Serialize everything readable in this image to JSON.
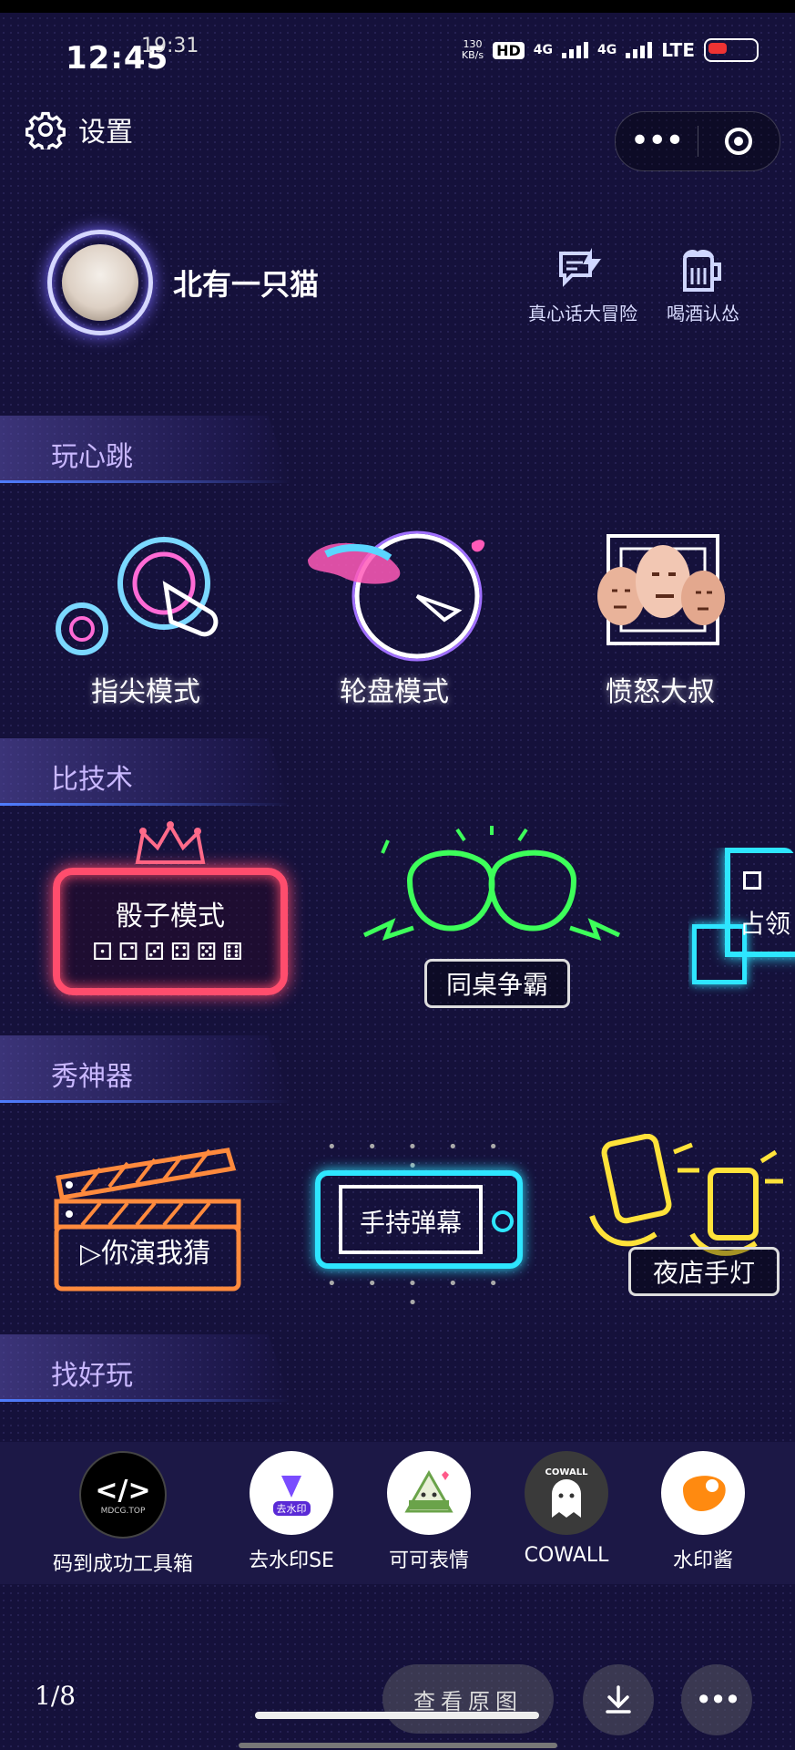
{
  "status": {
    "time": "12:45",
    "time_overlay": "19:31",
    "speed_top": "130",
    "speed_bottom": "KB/s",
    "hd": "HD",
    "net1": "4G",
    "net2": "4G",
    "lte": "LTE"
  },
  "header": {
    "settings_label": "设置"
  },
  "profile": {
    "nickname": "北有一只猫"
  },
  "quick_actions": [
    {
      "label": "真心话大冒险",
      "icon": "chat-bolt-icon"
    },
    {
      "label": "喝酒认怂",
      "icon": "beer-mug-icon"
    }
  ],
  "sections": [
    {
      "title": "玩心跳"
    },
    {
      "title": "比技术"
    },
    {
      "title": "秀神器"
    },
    {
      "title": "找好玩"
    }
  ],
  "heartbeat_tiles": [
    {
      "label": "指尖模式"
    },
    {
      "label": "轮盘模式"
    },
    {
      "label": "愤怒大叔"
    }
  ],
  "skill_cards": [
    {
      "label": "骰子模式"
    },
    {
      "label": "同桌争霸"
    },
    {
      "label": "占领"
    }
  ],
  "show_cards": [
    {
      "label": "你演我猜",
      "prefix": "▷"
    },
    {
      "label": "手持弹幕"
    },
    {
      "label": "夜店手灯"
    }
  ],
  "apps": [
    {
      "label": "码到成功工具箱",
      "badge": "MDCG.TOP",
      "glyph": "</>"
    },
    {
      "label": "去水印SE",
      "badge": "去水印"
    },
    {
      "label": "可可表情"
    },
    {
      "label": "COWALL",
      "badge": "COWALL"
    },
    {
      "label": "水印酱"
    }
  ],
  "footer": {
    "pager": "1/8",
    "view_original": "查看原图"
  },
  "colors": {
    "background": "#15113b",
    "accent_purple": "#c9b8ff",
    "neon_pink": "#ff4d6d",
    "neon_green": "#3dff5a",
    "neon_cyan": "#2ee6ff",
    "neon_yellow": "#ffe23a",
    "neon_orange": "#ff8a3d"
  }
}
